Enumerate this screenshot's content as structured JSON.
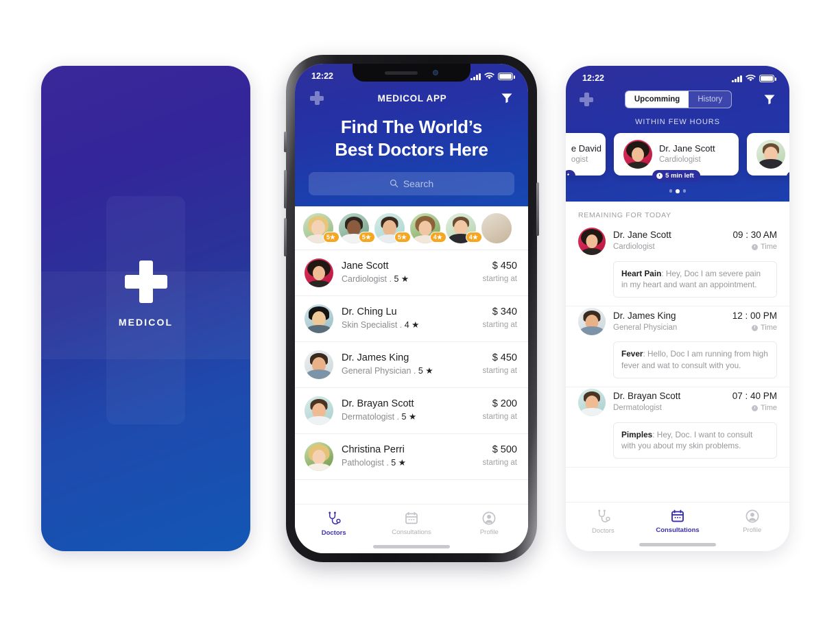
{
  "splash": {
    "brand": "MEDICOL",
    "logo_icon": "medical-cross-icon"
  },
  "phone_middle": {
    "status": {
      "time": "12:22",
      "signal_icon": "cellular-bars-icon",
      "wifi_icon": "wifi-icon",
      "battery_icon": "battery-full-icon"
    },
    "nav": {
      "left_icon": "medical-cross-icon",
      "title": "MEDICOL APP",
      "right_icon": "filter-funnel-icon"
    },
    "headline_line1": "Find The World’s",
    "headline_line2": "Best Doctors Here",
    "search": {
      "placeholder": "Search",
      "icon": "search-icon"
    },
    "top_doctors": [
      {
        "rating": "5",
        "star": "★"
      },
      {
        "rating": "5",
        "star": "★"
      },
      {
        "rating": "5",
        "star": "★"
      },
      {
        "rating": "4",
        "star": "★"
      },
      {
        "rating": "4",
        "star": "★"
      }
    ],
    "doctors": [
      {
        "name": "Jane Scott",
        "specialty": "Cardiologist",
        "rating": "5",
        "price": "$ 450",
        "price_note": "starting at"
      },
      {
        "name": "Dr. Ching Lu",
        "specialty": "Skin Specialist",
        "rating": "4",
        "price": "$ 340",
        "price_note": "starting at"
      },
      {
        "name": "Dr. James King",
        "specialty": "General Physician",
        "rating": "5",
        "price": "$ 450",
        "price_note": "starting at"
      },
      {
        "name": "Dr. Brayan Scott",
        "specialty": "Dermatologist",
        "rating": "5",
        "price": "$ 200",
        "price_note": "starting at"
      },
      {
        "name": "Christina Perri",
        "specialty": "Pathologist",
        "rating": "5",
        "price": "$ 500",
        "price_note": "starting at"
      }
    ],
    "tabs": [
      {
        "label": "Doctors",
        "icon": "stethoscope-icon",
        "active": true
      },
      {
        "label": "Consultations",
        "icon": "calendar-icon",
        "active": false
      },
      {
        "label": "Profile",
        "icon": "user-circle-icon",
        "active": false
      }
    ]
  },
  "phone_right": {
    "status": {
      "time": "12:22",
      "signal_icon": "cellular-bars-icon",
      "wifi_icon": "wifi-icon",
      "battery_icon": "battery-full-icon"
    },
    "nav": {
      "left_icon": "medical-cross-icon",
      "right_icon": "filter-funnel-icon"
    },
    "segments": [
      {
        "label": "Upcomming",
        "selected": true
      },
      {
        "label": "History",
        "selected": false
      }
    ],
    "section_title": "WITHIN FEW HOURS",
    "carousel": {
      "left_card": {
        "name": "e David",
        "specialty": "ogist",
        "badge": "t"
      },
      "main_card": {
        "name": "Dr. Jane Scott",
        "specialty": "Cardiologist",
        "badge": "5 min left",
        "badge_icon": "clock-icon"
      },
      "right_card": {
        "name": "",
        "specialty": ""
      },
      "page_dots": 3,
      "active_dot": 2
    },
    "list_label": "REMAINING FOR TODAY",
    "appointments": [
      {
        "name": "Dr. Jane Scott",
        "specialty": "Cardiologist",
        "time": "09 : 30 AM",
        "time_label": "Time",
        "time_icon": "clock-icon",
        "note_title": "Heart Pain",
        "note_body": ": Hey, Doc I am severe pain in my heart and want an appointment."
      },
      {
        "name": "Dr. James King",
        "specialty": "General Physician",
        "time": "12 : 00 PM",
        "time_label": "Time",
        "time_icon": "clock-icon",
        "note_title": "Fever",
        "note_body": ": Hello, Doc I am running from high fever and wat to consult with you."
      },
      {
        "name": "Dr. Brayan Scott",
        "specialty": "Dermatologist",
        "time": "07 : 40 PM",
        "time_label": "Time",
        "time_icon": "clock-icon",
        "note_title": "Pimples",
        "note_body": ": Hey, Doc. I want to consult with you about my skin problems."
      }
    ],
    "tabs": [
      {
        "label": "Doctors",
        "icon": "stethoscope-icon",
        "active": false
      },
      {
        "label": "Consultations",
        "icon": "calendar-icon",
        "active": true
      },
      {
        "label": "Profile",
        "icon": "user-circle-icon",
        "active": false
      }
    ]
  },
  "colors": {
    "brand_indigo": "#2d2f9c",
    "brand_blue": "#1848b2",
    "accent_orange": "#f5a623",
    "active_tab": "#3b2fb0",
    "page_background": "#ffffff"
  }
}
